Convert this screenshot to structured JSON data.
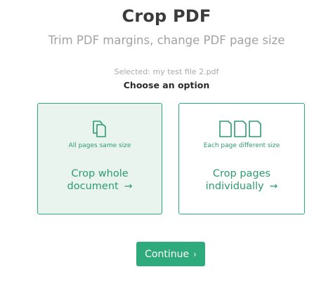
{
  "header": {
    "title": "Crop PDF",
    "subtitle": "Trim PDF margins, change PDF page size"
  },
  "file": {
    "selected_text": "Selected: my test file 2.pdf"
  },
  "prompt": "Choose an option",
  "options": [
    {
      "icon": "two-pages-icon",
      "caption": "All pages same size",
      "label_line1": "Crop whole",
      "label_line2": "document",
      "arrow": "→",
      "selected": true
    },
    {
      "icon": "three-pages-icon",
      "caption": "Each page different size",
      "label_line1": "Crop pages",
      "label_line2": "individually",
      "arrow": "→",
      "selected": false
    }
  ],
  "continue_button": {
    "label": "Continue",
    "chevron": "›"
  },
  "colors": {
    "accent": "#2eaa7d",
    "accent_text": "#2e9a70",
    "selected_bg": "#eaf4ef",
    "title": "#3b3b3b",
    "muted": "#a2a2a2"
  }
}
